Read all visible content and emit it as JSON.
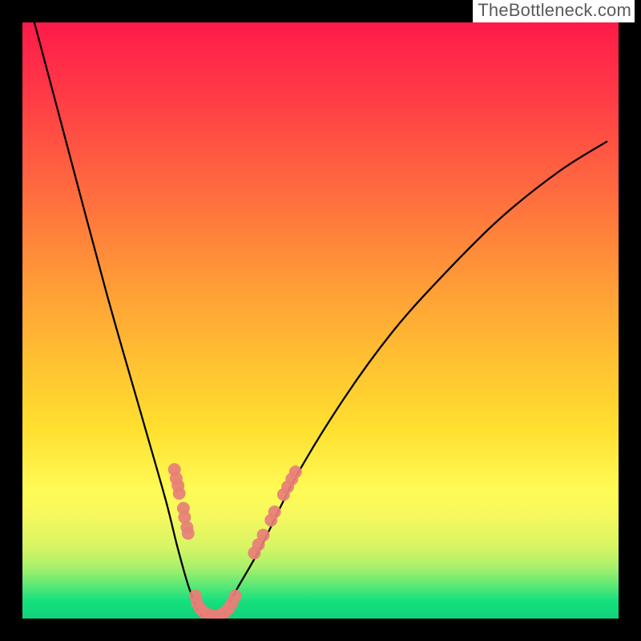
{
  "watermark": "TheBottleneck.com",
  "chart_data": {
    "type": "line",
    "title": "",
    "xlabel": "",
    "ylabel": "",
    "xlim": [
      0,
      100
    ],
    "ylim": [
      0,
      100
    ],
    "grid": false,
    "series": [
      {
        "name": "curve",
        "x": [
          2,
          6,
          14,
          20,
          24,
          26,
          28,
          30,
          31.5,
          33.5,
          36,
          40,
          46,
          54,
          62,
          70,
          80,
          90,
          98
        ],
        "y": [
          100,
          85,
          55,
          34,
          20,
          12,
          5,
          0.5,
          0,
          0.5,
          5,
          12,
          24,
          37,
          48,
          57,
          67,
          75,
          80
        ]
      }
    ],
    "markers": {
      "name": "salmon-dots",
      "points": [
        {
          "x": 25.5,
          "y": 25.0
        },
        {
          "x": 25.8,
          "y": 23.5
        },
        {
          "x": 26.1,
          "y": 22.3
        },
        {
          "x": 26.3,
          "y": 21.0
        },
        {
          "x": 27.0,
          "y": 18.5
        },
        {
          "x": 27.2,
          "y": 17.0
        },
        {
          "x": 27.6,
          "y": 15.3
        },
        {
          "x": 27.8,
          "y": 14.3
        },
        {
          "x": 29.0,
          "y": 3.8
        },
        {
          "x": 29.3,
          "y": 2.7
        },
        {
          "x": 29.8,
          "y": 1.7
        },
        {
          "x": 30.4,
          "y": 1.1
        },
        {
          "x": 31.1,
          "y": 0.7
        },
        {
          "x": 31.9,
          "y": 0.4
        },
        {
          "x": 32.7,
          "y": 0.4
        },
        {
          "x": 33.4,
          "y": 0.7
        },
        {
          "x": 34.0,
          "y": 1.1
        },
        {
          "x": 34.6,
          "y": 1.7
        },
        {
          "x": 35.2,
          "y": 2.7
        },
        {
          "x": 35.7,
          "y": 3.8
        },
        {
          "x": 38.9,
          "y": 11.0
        },
        {
          "x": 39.6,
          "y": 12.4
        },
        {
          "x": 40.4,
          "y": 14.0
        },
        {
          "x": 41.7,
          "y": 16.5
        },
        {
          "x": 42.3,
          "y": 17.9
        },
        {
          "x": 43.8,
          "y": 20.8
        },
        {
          "x": 44.5,
          "y": 22.1
        },
        {
          "x": 45.2,
          "y": 23.4
        },
        {
          "x": 45.8,
          "y": 24.6
        }
      ]
    },
    "gradient_bands": [
      {
        "from_y": 0,
        "to_y": 3,
        "color": "#16e07e"
      },
      {
        "from_y": 3,
        "to_y": 5,
        "color": "#5ae876"
      },
      {
        "from_y": 5,
        "to_y": 8,
        "color": "#a6f06b"
      },
      {
        "from_y": 8,
        "to_y": 12,
        "color": "#d7f564"
      },
      {
        "from_y": 12,
        "to_y": 17,
        "color": "#f5f85e"
      },
      {
        "from_y": 17,
        "to_y": 22,
        "color": "#fffb56"
      }
    ]
  }
}
